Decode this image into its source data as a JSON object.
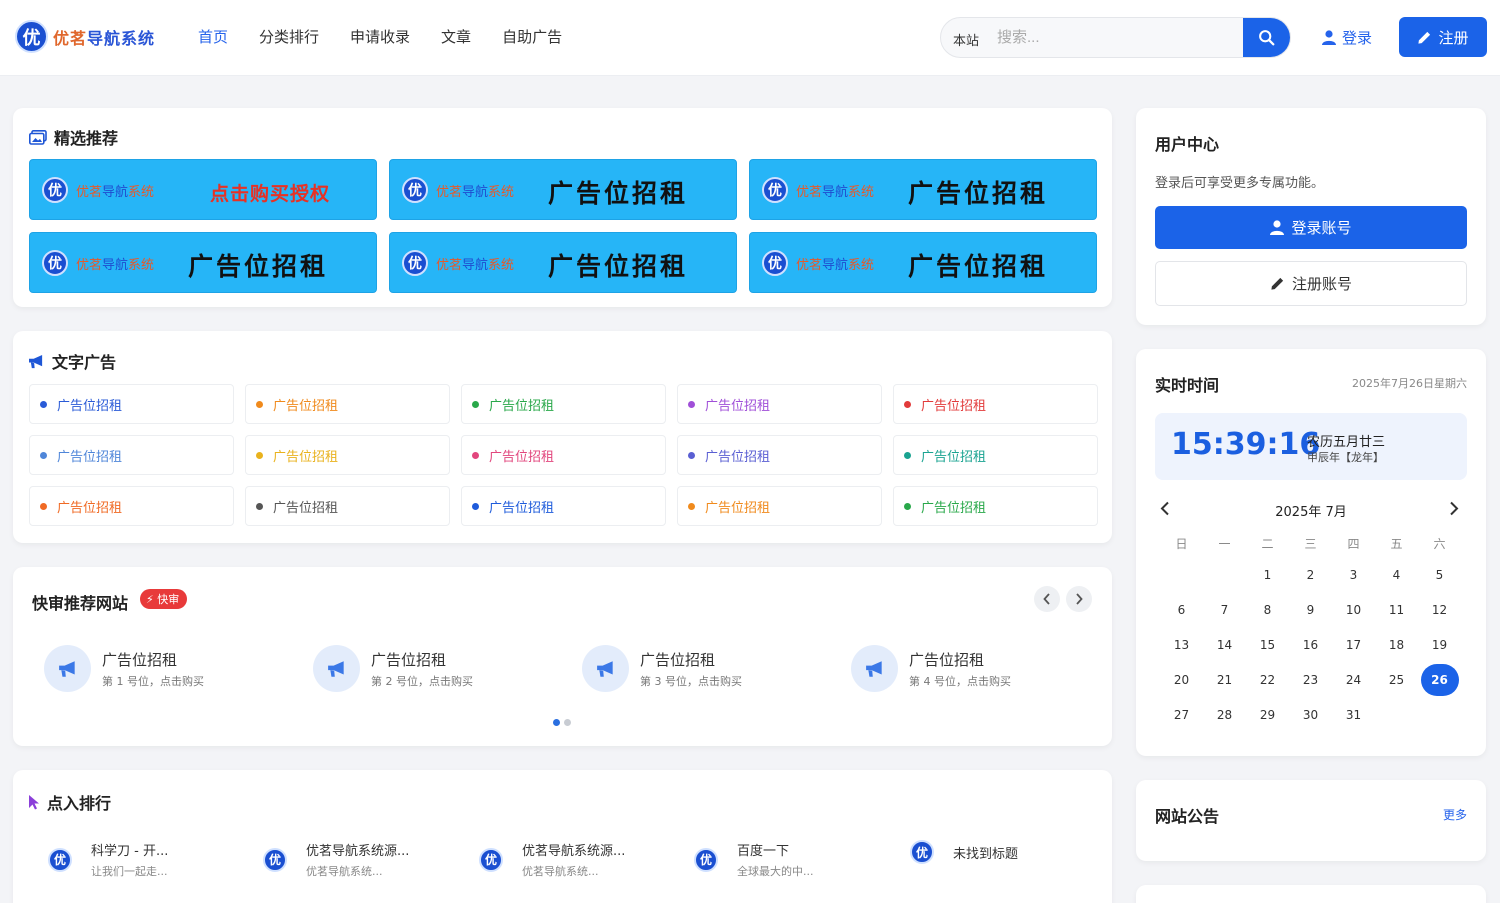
{
  "header": {
    "logo_badge": "优",
    "logo_part1": "优茗",
    "logo_part2": "导航",
    "logo_part3": "系统",
    "nav": [
      "首页",
      "分类排行",
      "申请收录",
      "文章",
      "自助广告"
    ],
    "search_scope": "本站",
    "search_placeholder": "搜索...",
    "login": "登录",
    "register": "注册"
  },
  "featured": {
    "title": "精选推荐",
    "ads": [
      {
        "brand1": "优茗",
        "brand2": "导航",
        "brand3": "系统",
        "text": "点击购买授权"
      },
      {
        "brand1": "优茗",
        "brand2": "导航",
        "brand3": "系统",
        "text": "广告位招租"
      },
      {
        "brand1": "优茗",
        "brand2": "导航",
        "brand3": "系统",
        "text": "广告位招租"
      },
      {
        "brand1": "优茗",
        "brand2": "导航",
        "brand3": "系统",
        "text": "广告位招租"
      },
      {
        "brand1": "优茗",
        "brand2": "导航",
        "brand3": "系统",
        "text": "广告位招租"
      },
      {
        "brand1": "优茗",
        "brand2": "导航",
        "brand3": "系统",
        "text": "广告位招租"
      }
    ]
  },
  "text_ads": {
    "title": "文字广告",
    "items": [
      {
        "label": "广告位招租",
        "color": "#2a5bd7"
      },
      {
        "label": "广告位招租",
        "color": "#f08a1c"
      },
      {
        "label": "广告位招租",
        "color": "#29a84a"
      },
      {
        "label": "广告位招租",
        "color": "#a04fd8"
      },
      {
        "label": "广告位招租",
        "color": "#e23b3b"
      },
      {
        "label": "广告位招租",
        "color": "#4f86d9"
      },
      {
        "label": "广告位招租",
        "color": "#e9b21d"
      },
      {
        "label": "广告位招租",
        "color": "#e2467d"
      },
      {
        "label": "广告位招租",
        "color": "#5a5fd3"
      },
      {
        "label": "广告位招租",
        "color": "#1aa391"
      },
      {
        "label": "广告位招租",
        "color": "#f06a24"
      },
      {
        "label": "广告位招租",
        "color": "#555555"
      },
      {
        "label": "广告位招租",
        "color": "#1e5bdb"
      },
      {
        "label": "广告位招租",
        "color": "#f08a1c"
      },
      {
        "label": "广告位招租",
        "color": "#29a84a"
      }
    ]
  },
  "fast": {
    "title": "快审推荐网站",
    "badge": "⚡ 快审",
    "items": [
      {
        "name": "广告位招租",
        "sub": "第 1 号位，点击购买"
      },
      {
        "name": "广告位招租",
        "sub": "第 2 号位，点击购买"
      },
      {
        "name": "广告位招租",
        "sub": "第 3 号位，点击购买"
      },
      {
        "name": "广告位招租",
        "sub": "第 4 号位，点击购买"
      }
    ]
  },
  "rank": {
    "title": "点入排行",
    "items": [
      {
        "name": "科学刀 - 开...",
        "sub": "让我们一起走..."
      },
      {
        "name": "优茗导航系统源...",
        "sub": "优茗导航系统..."
      },
      {
        "name": "优茗导航系统源...",
        "sub": "优茗导航系统..."
      },
      {
        "name": "百度一下",
        "sub": "全球最大的中..."
      },
      {
        "name": "未找到标题",
        "sub": ""
      }
    ]
  },
  "user_center": {
    "title": "用户中心",
    "desc": "登录后可享受更多专属功能。",
    "login_btn": "登录账号",
    "register_btn": "注册账号"
  },
  "clock": {
    "title": "实时时间",
    "date": "2025年7月26日星期六",
    "time": "15:39:16",
    "lunar": "农历五月廿三",
    "ganzhi": "甲辰年【龙年】",
    "month": "2025年 7月",
    "weekdays": [
      "日",
      "一",
      "二",
      "三",
      "四",
      "五",
      "六"
    ],
    "weeks": [
      [
        "",
        "",
        "1",
        "2",
        "3",
        "4",
        "5"
      ],
      [
        "6",
        "7",
        "8",
        "9",
        "10",
        "11",
        "12"
      ],
      [
        "13",
        "14",
        "15",
        "16",
        "17",
        "18",
        "19"
      ],
      [
        "20",
        "21",
        "22",
        "23",
        "24",
        "25",
        "26"
      ],
      [
        "27",
        "28",
        "29",
        "30",
        "31",
        "",
        ""
      ]
    ],
    "today": "26"
  },
  "notice": {
    "title": "网站公告",
    "more": "更多"
  },
  "colors": {
    "accent": "#1b63e8",
    "ad_bg": "#26b5f7"
  }
}
